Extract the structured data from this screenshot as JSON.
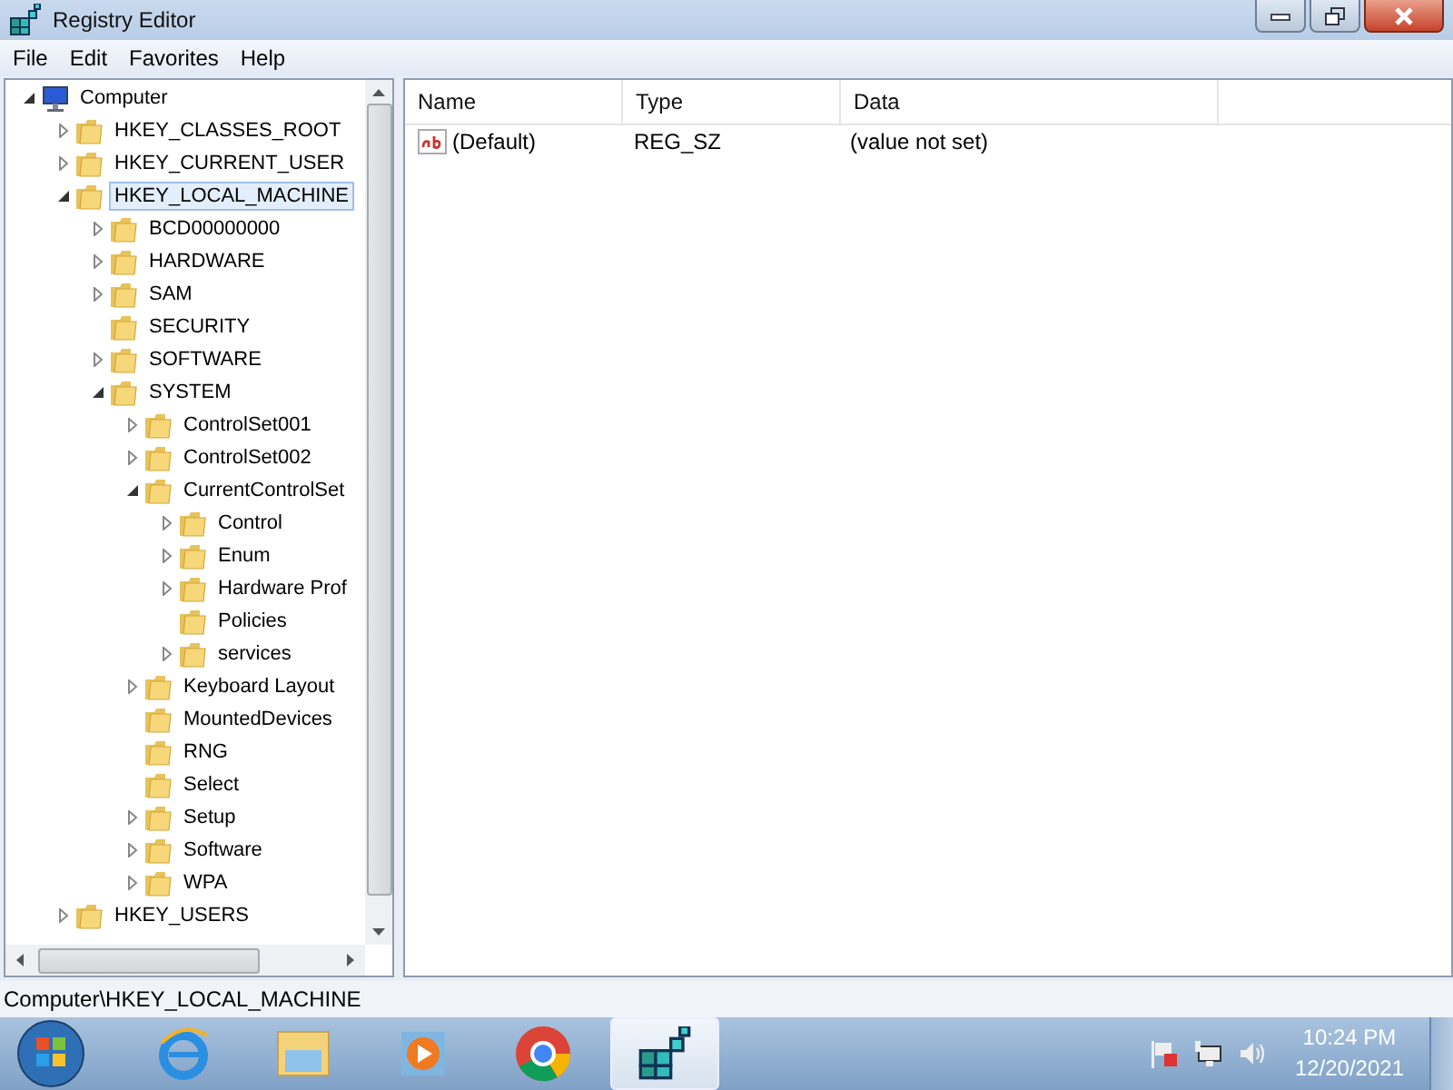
{
  "window": {
    "title": "Registry Editor"
  },
  "menu": [
    {
      "label": "File"
    },
    {
      "label": "Edit"
    },
    {
      "label": "Favorites"
    },
    {
      "label": "Help"
    }
  ],
  "tree": {
    "label": "Computer",
    "expanded": true,
    "selected": false,
    "children": [
      {
        "label": "HKEY_CLASSES_ROOT",
        "expanded": false,
        "selected": false
      },
      {
        "label": "HKEY_CURRENT_USER",
        "expanded": false,
        "selected": false
      },
      {
        "label": "HKEY_LOCAL_MACHINE",
        "expanded": true,
        "selected": true,
        "children": [
          {
            "label": "BCD00000000",
            "expanded": false,
            "selected": false
          },
          {
            "label": "HARDWARE",
            "expanded": false,
            "selected": false
          },
          {
            "label": "SAM",
            "expanded": false,
            "selected": false
          },
          {
            "label": "SECURITY",
            "selected": false
          },
          {
            "label": "SOFTWARE",
            "expanded": false,
            "selected": false
          },
          {
            "label": "SYSTEM",
            "expanded": true,
            "selected": false,
            "children": [
              {
                "label": "ControlSet001",
                "expanded": false,
                "selected": false
              },
              {
                "label": "ControlSet002",
                "expanded": false,
                "selected": false
              },
              {
                "label": "CurrentControlSet",
                "expanded": true,
                "selected": false,
                "children": [
                  {
                    "label": "Control",
                    "expanded": false,
                    "selected": false
                  },
                  {
                    "label": "Enum",
                    "expanded": false,
                    "selected": false
                  },
                  {
                    "label": "Hardware Prof",
                    "expanded": false,
                    "selected": false
                  },
                  {
                    "label": "Policies",
                    "selected": false
                  },
                  {
                    "label": "services",
                    "expanded": false,
                    "selected": false
                  }
                ]
              },
              {
                "label": "Keyboard Layout",
                "expanded": false,
                "selected": false
              },
              {
                "label": "MountedDevices",
                "selected": false
              },
              {
                "label": "RNG",
                "selected": false
              },
              {
                "label": "Select",
                "selected": false
              },
              {
                "label": "Setup",
                "expanded": false,
                "selected": false
              },
              {
                "label": "Software",
                "expanded": false,
                "selected": false
              },
              {
                "label": "WPA",
                "expanded": false,
                "selected": false
              }
            ]
          }
        ]
      },
      {
        "label": "HKEY_USERS",
        "expanded": false,
        "selected": false
      }
    ]
  },
  "table": {
    "columns": [
      "Name",
      "Type",
      "Data"
    ],
    "rows": [
      {
        "name": "(Default)",
        "type": "REG_SZ",
        "data": "(value not set)"
      }
    ]
  },
  "status_bar": "Computer\\HKEY_LOCAL_MACHINE",
  "taskbar": {
    "time": "10:24 PM",
    "date": "12/20/2021"
  }
}
